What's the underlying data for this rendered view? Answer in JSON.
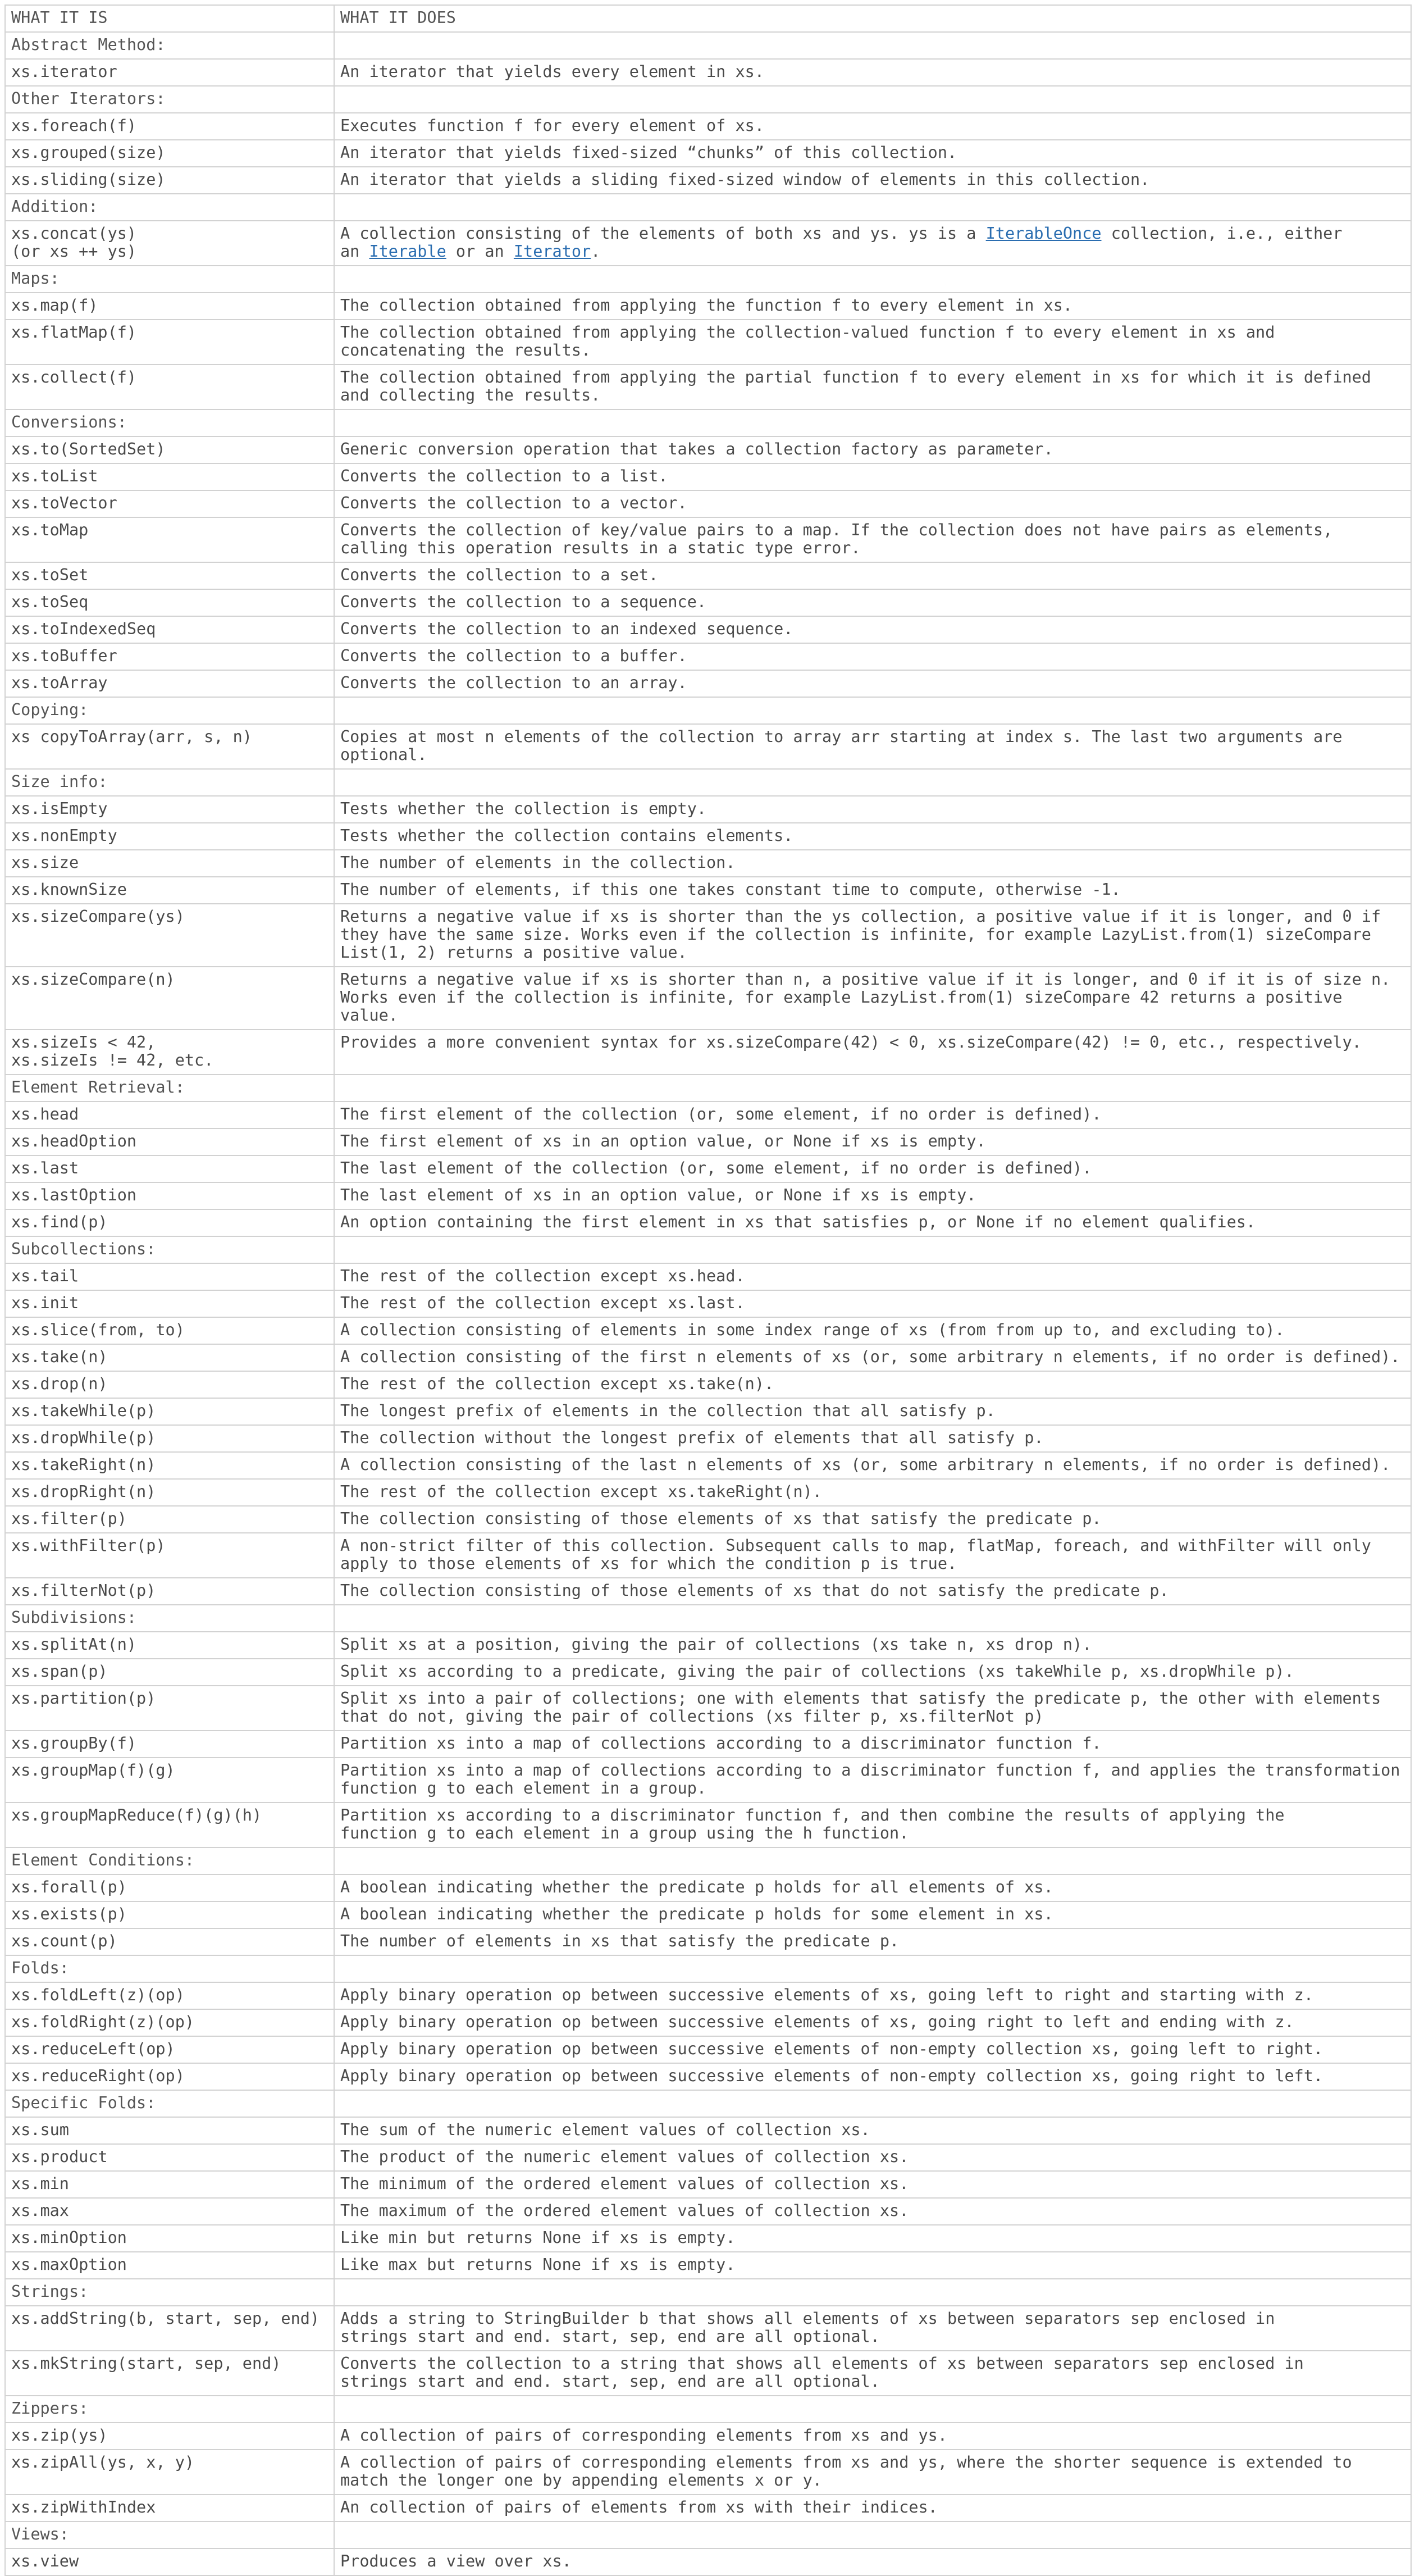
{
  "header": {
    "col1": "WHAT IT IS",
    "col2": "WHAT IT DOES"
  },
  "rows": [
    {
      "g": "Abstract Method:"
    },
    {
      "a": "xs.iterator",
      "b": [
        [
          "An iterator that yields every element in xs."
        ]
      ]
    },
    {
      "g": "Other Iterators:"
    },
    {
      "a": "xs.foreach(f)",
      "b": [
        [
          "Executes function f for every element of xs."
        ]
      ]
    },
    {
      "a": "xs.grouped(size)",
      "b": [
        [
          "An iterator that yields fixed-sized “chunks” of this collection."
        ]
      ]
    },
    {
      "a": "xs.sliding(size)",
      "b": [
        [
          "An iterator that yields a sliding fixed-sized window of elements in this collection."
        ]
      ]
    },
    {
      "g": "Addition:"
    },
    {
      "a": "xs.concat(ys)\n(or xs ++ ys)",
      "b": [
        [
          "A collection consisting of the elements of both xs and ys. ys is a "
        ],
        [
          "IterableOnce",
          1
        ],
        [
          " collection, i.e., either\nan "
        ],
        [
          "Iterable",
          1
        ],
        [
          " or an "
        ],
        [
          "Iterator",
          1
        ],
        [
          "."
        ]
      ]
    },
    {
      "g": "Maps:"
    },
    {
      "a": "xs.map(f)",
      "b": [
        [
          "The collection obtained from applying the function f to every element in xs."
        ]
      ]
    },
    {
      "a": "xs.flatMap(f)",
      "b": [
        [
          "The collection obtained from applying the collection-valued function f to every element in xs and\nconcatenating the results."
        ]
      ]
    },
    {
      "a": "xs.collect(f)",
      "b": [
        [
          "The collection obtained from applying the partial function f to every element in xs for which it is defined\nand collecting the results."
        ]
      ]
    },
    {
      "g": "Conversions:"
    },
    {
      "a": "xs.to(SortedSet)",
      "b": [
        [
          "Generic conversion operation that takes a collection factory as parameter."
        ]
      ]
    },
    {
      "a": "xs.toList",
      "b": [
        [
          "Converts the collection to a list."
        ]
      ]
    },
    {
      "a": "xs.toVector",
      "b": [
        [
          "Converts the collection to a vector."
        ]
      ]
    },
    {
      "a": "xs.toMap",
      "b": [
        [
          "Converts the collection of key/value pairs to a map. If the collection does not have pairs as elements,\ncalling this operation results in a static type error."
        ]
      ]
    },
    {
      "a": "xs.toSet",
      "b": [
        [
          "Converts the collection to a set."
        ]
      ]
    },
    {
      "a": "xs.toSeq",
      "b": [
        [
          "Converts the collection to a sequence."
        ]
      ]
    },
    {
      "a": "xs.toIndexedSeq",
      "b": [
        [
          "Converts the collection to an indexed sequence."
        ]
      ]
    },
    {
      "a": "xs.toBuffer",
      "b": [
        [
          "Converts the collection to a buffer."
        ]
      ]
    },
    {
      "a": "xs.toArray",
      "b": [
        [
          "Converts the collection to an array."
        ]
      ]
    },
    {
      "g": "Copying:"
    },
    {
      "a": "xs copyToArray(arr, s, n)",
      "b": [
        [
          "Copies at most n elements of the collection to array arr starting at index s. The last two arguments are\noptional."
        ]
      ]
    },
    {
      "g": "Size info:"
    },
    {
      "a": "xs.isEmpty",
      "b": [
        [
          "Tests whether the collection is empty."
        ]
      ]
    },
    {
      "a": "xs.nonEmpty",
      "b": [
        [
          "Tests whether the collection contains elements."
        ]
      ]
    },
    {
      "a": "xs.size",
      "b": [
        [
          "The number of elements in the collection."
        ]
      ]
    },
    {
      "a": "xs.knownSize",
      "b": [
        [
          "The number of elements, if this one takes constant time to compute, otherwise -1."
        ]
      ]
    },
    {
      "a": "xs.sizeCompare(ys)",
      "b": [
        [
          "Returns a negative value if xs is shorter than the ys collection, a positive value if it is longer, and 0 if\nthey have the same size. Works even if the collection is infinite, for example LazyList.from(1) sizeCompare\nList(1, 2) returns a positive value."
        ]
      ]
    },
    {
      "a": "xs.sizeCompare(n)",
      "b": [
        [
          "Returns a negative value if xs is shorter than n, a positive value if it is longer, and 0 if it is of size n.\nWorks even if the collection is infinite, for example LazyList.from(1) sizeCompare 42 returns a positive\nvalue."
        ]
      ]
    },
    {
      "a": "xs.sizeIs < 42,\nxs.sizeIs != 42, etc.",
      "b": [
        [
          "Provides a more convenient syntax for xs.sizeCompare(42) < 0, xs.sizeCompare(42) != 0, etc., respectively."
        ]
      ]
    },
    {
      "g": "Element Retrieval:"
    },
    {
      "a": "xs.head",
      "b": [
        [
          "The first element of the collection (or, some element, if no order is defined)."
        ]
      ]
    },
    {
      "a": "xs.headOption",
      "b": [
        [
          "The first element of xs in an option value, or None if xs is empty."
        ]
      ]
    },
    {
      "a": "xs.last",
      "b": [
        [
          "The last element of the collection (or, some element, if no order is defined)."
        ]
      ]
    },
    {
      "a": "xs.lastOption",
      "b": [
        [
          "The last element of xs in an option value, or None if xs is empty."
        ]
      ]
    },
    {
      "a": "xs.find(p)",
      "b": [
        [
          "An option containing the first element in xs that satisfies p, or None if no element qualifies."
        ]
      ]
    },
    {
      "g": "Subcollections:"
    },
    {
      "a": "xs.tail",
      "b": [
        [
          "The rest of the collection except xs.head."
        ]
      ]
    },
    {
      "a": "xs.init",
      "b": [
        [
          "The rest of the collection except xs.last."
        ]
      ]
    },
    {
      "a": "xs.slice(from, to)",
      "b": [
        [
          "A collection consisting of elements in some index range of xs (from from up to, and excluding to)."
        ]
      ]
    },
    {
      "a": "xs.take(n)",
      "b": [
        [
          "A collection consisting of the first n elements of xs (or, some arbitrary n elements, if no order is defined)."
        ]
      ]
    },
    {
      "a": "xs.drop(n)",
      "b": [
        [
          "The rest of the collection except xs.take(n)."
        ]
      ]
    },
    {
      "a": "xs.takeWhile(p)",
      "b": [
        [
          "The longest prefix of elements in the collection that all satisfy p."
        ]
      ]
    },
    {
      "a": "xs.dropWhile(p)",
      "b": [
        [
          "The collection without the longest prefix of elements that all satisfy p."
        ]
      ]
    },
    {
      "a": "xs.takeRight(n)",
      "b": [
        [
          "A collection consisting of the last n elements of xs (or, some arbitrary n elements, if no order is defined)."
        ]
      ]
    },
    {
      "a": "xs.dropRight(n)",
      "b": [
        [
          "The rest of the collection except xs.takeRight(n)."
        ]
      ]
    },
    {
      "a": "xs.filter(p)",
      "b": [
        [
          "The collection consisting of those elements of xs that satisfy the predicate p."
        ]
      ]
    },
    {
      "a": "xs.withFilter(p)",
      "b": [
        [
          "A non-strict filter of this collection. Subsequent calls to map, flatMap, foreach, and withFilter will only\napply to those elements of xs for which the condition p is true."
        ]
      ]
    },
    {
      "a": "xs.filterNot(p)",
      "b": [
        [
          "The collection consisting of those elements of xs that do not satisfy the predicate p."
        ]
      ]
    },
    {
      "g": "Subdivisions:"
    },
    {
      "a": "xs.splitAt(n)",
      "b": [
        [
          "Split xs at a position, giving the pair of collections (xs take n, xs drop n)."
        ]
      ]
    },
    {
      "a": "xs.span(p)",
      "b": [
        [
          "Split xs according to a predicate, giving the pair of collections (xs takeWhile p, xs.dropWhile p)."
        ]
      ]
    },
    {
      "a": "xs.partition(p)",
      "b": [
        [
          "Split xs into a pair of collections; one with elements that satisfy the predicate p, the other with elements\nthat do not, giving the pair of collections (xs filter p, xs.filterNot p)"
        ]
      ]
    },
    {
      "a": "xs.groupBy(f)",
      "b": [
        [
          "Partition xs into a map of collections according to a discriminator function f."
        ]
      ]
    },
    {
      "a": "xs.groupMap(f)(g)",
      "b": [
        [
          "Partition xs into a map of collections according to a discriminator function f, and applies the transformation\nfunction g to each element in a group."
        ]
      ]
    },
    {
      "a": "xs.groupMapReduce(f)(g)(h)",
      "b": [
        [
          "Partition xs according to a discriminator function f, and then combine the results of applying the\nfunction g to each element in a group using the h function."
        ]
      ]
    },
    {
      "g": "Element Conditions:"
    },
    {
      "a": "xs.forall(p)",
      "b": [
        [
          "A boolean indicating whether the predicate p holds for all elements of xs."
        ]
      ]
    },
    {
      "a": "xs.exists(p)",
      "b": [
        [
          "A boolean indicating whether the predicate p holds for some element in xs."
        ]
      ]
    },
    {
      "a": "xs.count(p)",
      "b": [
        [
          "The number of elements in xs that satisfy the predicate p."
        ]
      ]
    },
    {
      "g": "Folds:"
    },
    {
      "a": "xs.foldLeft(z)(op)",
      "b": [
        [
          "Apply binary operation op between successive elements of xs, going left to right and starting with z."
        ]
      ]
    },
    {
      "a": "xs.foldRight(z)(op)",
      "b": [
        [
          "Apply binary operation op between successive elements of xs, going right to left and ending with z."
        ]
      ]
    },
    {
      "a": "xs.reduceLeft(op)",
      "b": [
        [
          "Apply binary operation op between successive elements of non-empty collection xs, going left to right."
        ]
      ]
    },
    {
      "a": "xs.reduceRight(op)",
      "b": [
        [
          "Apply binary operation op between successive elements of non-empty collection xs, going right to left."
        ]
      ]
    },
    {
      "g": "Specific Folds:"
    },
    {
      "a": "xs.sum",
      "b": [
        [
          "The sum of the numeric element values of collection xs."
        ]
      ]
    },
    {
      "a": "xs.product",
      "b": [
        [
          "The product of the numeric element values of collection xs."
        ]
      ]
    },
    {
      "a": "xs.min",
      "b": [
        [
          "The minimum of the ordered element values of collection xs."
        ]
      ]
    },
    {
      "a": "xs.max",
      "b": [
        [
          "The maximum of the ordered element values of collection xs."
        ]
      ]
    },
    {
      "a": "xs.minOption",
      "b": [
        [
          "Like min but returns None if xs is empty."
        ]
      ]
    },
    {
      "a": "xs.maxOption",
      "b": [
        [
          "Like max but returns None if xs is empty."
        ]
      ]
    },
    {
      "g": "Strings:"
    },
    {
      "a": "xs.addString(b, start, sep, end)",
      "b": [
        [
          "Adds a string to StringBuilder b that shows all elements of xs between separators sep enclosed in\nstrings start and end. start, sep, end are all optional."
        ]
      ]
    },
    {
      "a": "xs.mkString(start, sep, end)",
      "b": [
        [
          "Converts the collection to a string that shows all elements of xs between separators sep enclosed in\nstrings start and end. start, sep, end are all optional."
        ]
      ]
    },
    {
      "g": "Zippers:"
    },
    {
      "a": "xs.zip(ys)",
      "b": [
        [
          "A collection of pairs of corresponding elements from xs and ys."
        ]
      ]
    },
    {
      "a": "xs.zipAll(ys, x, y)",
      "b": [
        [
          "A collection of pairs of corresponding elements from xs and ys, where the shorter sequence is extended to\nmatch the longer one by appending elements x or y."
        ]
      ]
    },
    {
      "a": "xs.zipWithIndex",
      "b": [
        [
          "An collection of pairs of elements from xs with their indices."
        ]
      ]
    },
    {
      "g": "Views:"
    },
    {
      "a": "xs.view",
      "b": [
        [
          "Produces a view over xs."
        ]
      ]
    }
  ]
}
